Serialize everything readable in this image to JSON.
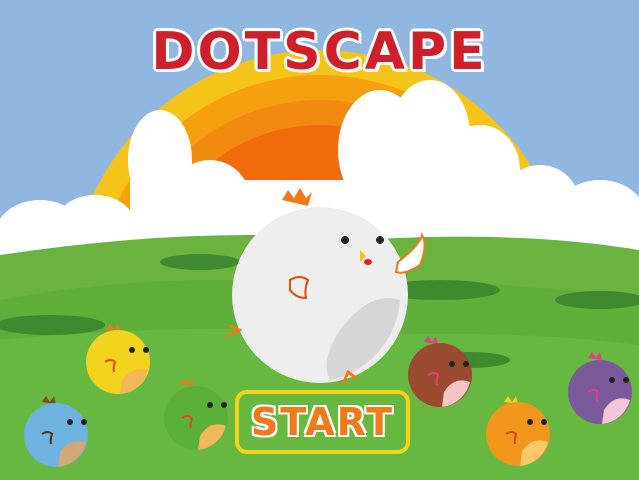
{
  "game": {
    "title": "DOTSCAPE",
    "start_label": "START"
  },
  "colors": {
    "sky": "#8fb7e0",
    "grass": "#5fae3a",
    "title_red": "#cf1f2b",
    "start_orange": "#f07a1a",
    "button_border": "#f4d31c"
  },
  "characters": [
    {
      "name": "white-chicken",
      "color": "#eeeeee"
    },
    {
      "name": "yellow-chick",
      "color": "#f2d41f"
    },
    {
      "name": "blue-chick",
      "color": "#6fb3e0"
    },
    {
      "name": "green-chick",
      "color": "#5bb03a"
    },
    {
      "name": "brown-chick",
      "color": "#9a4a2e"
    },
    {
      "name": "orange-chick",
      "color": "#f2961c"
    },
    {
      "name": "purple-chick",
      "color": "#7a5a9a"
    }
  ]
}
